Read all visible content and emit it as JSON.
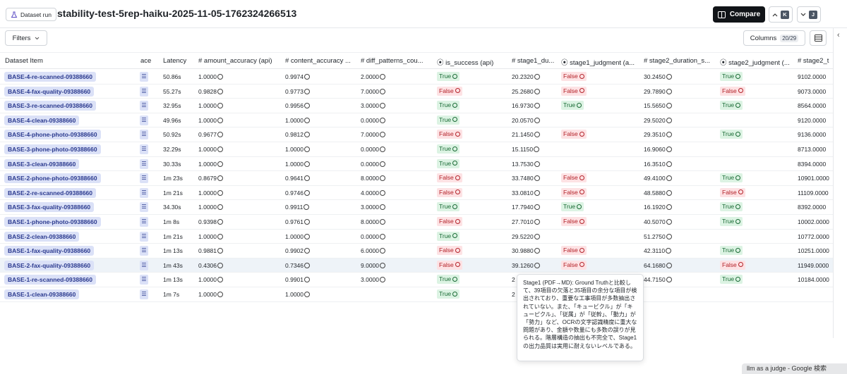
{
  "header": {
    "badge_label": "Dataset run",
    "title": "stability-test-5rep-haiku-2025-11-05-1762324266513",
    "compare_label": "Compare",
    "prev_key": "K",
    "next_key": "J"
  },
  "toolbar": {
    "filters_label": "Filters",
    "columns_label": "Columns",
    "columns_count": "20/29"
  },
  "table": {
    "headers": {
      "dataset_item": "Dataset Item",
      "trace": "ace",
      "latency": "Latency",
      "amount_accuracy": "# amount_accuracy (api)",
      "content_accuracy": "# content_accuracy ...",
      "diff_patterns": "# diff_patterns_cou...",
      "is_success": "⦿ is_success (api)",
      "stage1_duration": "# stage1_du...",
      "stage1_judgment": "⦿ stage1_judgment (a...",
      "stage2_duration": "# stage2_duration_s...",
      "stage2_judgment": "⦿ stage2_judgment (...",
      "stage2_t": "# stage2_t"
    },
    "rows": [
      {
        "item": "BASE-4-re-scanned-09388660",
        "latency": "50.86s",
        "amount": "1.0000",
        "content": "0.9974",
        "diff": "2.0000",
        "success": "True",
        "s1d": "20.2320",
        "s1j": "False",
        "s2d": "30.2450",
        "s2j": "True",
        "s2t": "9102.0000"
      },
      {
        "item": "BASE-4-fax-quality-09388660",
        "latency": "55.27s",
        "amount": "0.9828",
        "content": "0.9773",
        "diff": "7.0000",
        "success": "False",
        "s1d": "25.2680",
        "s1j": "False",
        "s2d": "29.7890",
        "s2j": "False",
        "s2t": "9073.0000"
      },
      {
        "item": "BASE-3-re-scanned-09388660",
        "latency": "32.95s",
        "amount": "1.0000",
        "content": "0.9956",
        "diff": "3.0000",
        "success": "True",
        "s1d": "16.9730",
        "s1j": "True",
        "s2d": "15.5650",
        "s2j": "True",
        "s2t": "8564.0000"
      },
      {
        "item": "BASE-4-clean-09388660",
        "latency": "49.96s",
        "amount": "1.0000",
        "content": "1.0000",
        "diff": "0.0000",
        "success": "True",
        "s1d": "20.0570",
        "s1j": "",
        "s2d": "29.5020",
        "s2j": "",
        "s2t": "9120.0000"
      },
      {
        "item": "BASE-4-phone-photo-09388660",
        "latency": "50.92s",
        "amount": "0.9677",
        "content": "0.9812",
        "diff": "7.0000",
        "success": "False",
        "s1d": "21.1450",
        "s1j": "False",
        "s2d": "29.3510",
        "s2j": "True",
        "s2t": "9136.0000"
      },
      {
        "item": "BASE-3-phone-photo-09388660",
        "latency": "32.29s",
        "amount": "1.0000",
        "content": "1.0000",
        "diff": "0.0000",
        "success": "True",
        "s1d": "15.1150",
        "s1j": "",
        "s2d": "16.9060",
        "s2j": "",
        "s2t": "8713.0000"
      },
      {
        "item": "BASE-3-clean-09388660",
        "latency": "30.33s",
        "amount": "1.0000",
        "content": "1.0000",
        "diff": "0.0000",
        "success": "True",
        "s1d": "13.7530",
        "s1j": "",
        "s2d": "16.3510",
        "s2j": "",
        "s2t": "8394.0000"
      },
      {
        "item": "BASE-2-phone-photo-09388660",
        "latency": "1m 23s",
        "amount": "0.8679",
        "content": "0.9641",
        "diff": "8.0000",
        "success": "False",
        "s1d": "33.7480",
        "s1j": "False",
        "s2d": "49.4100",
        "s2j": "True",
        "s2t": "10901.0000"
      },
      {
        "item": "BASE-2-re-scanned-09388660",
        "latency": "1m 21s",
        "amount": "1.0000",
        "content": "0.9746",
        "diff": "4.0000",
        "success": "False",
        "s1d": "33.0810",
        "s1j": "False",
        "s2d": "48.5880",
        "s2j": "False",
        "s2t": "11109.0000"
      },
      {
        "item": "BASE-3-fax-quality-09388660",
        "latency": "34.30s",
        "amount": "1.0000",
        "content": "0.9911",
        "diff": "3.0000",
        "success": "True",
        "s1d": "17.7940",
        "s1j": "True",
        "s2d": "16.1920",
        "s2j": "True",
        "s2t": "8392.0000"
      },
      {
        "item": "BASE-1-phone-photo-09388660",
        "latency": "1m 8s",
        "amount": "0.9398",
        "content": "0.9761",
        "diff": "8.0000",
        "success": "False",
        "s1d": "27.7010",
        "s1j": "False",
        "s2d": "40.5070",
        "s2j": "True",
        "s2t": "10002.0000"
      },
      {
        "item": "BASE-2-clean-09388660",
        "latency": "1m 21s",
        "amount": "1.0000",
        "content": "1.0000",
        "diff": "0.0000",
        "success": "True",
        "s1d": "29.5220",
        "s1j": "",
        "s2d": "51.2750",
        "s2j": "",
        "s2t": "10772.0000"
      },
      {
        "item": "BASE-1-fax-quality-09388660",
        "latency": "1m 13s",
        "amount": "0.9881",
        "content": "0.9902",
        "diff": "6.0000",
        "success": "False",
        "s1d": "30.9880",
        "s1j": "False",
        "s2d": "42.3110",
        "s2j": "True",
        "s2t": "10251.0000"
      },
      {
        "item": "BASE-2-fax-quality-09388660",
        "latency": "1m 43s",
        "amount": "0.4306",
        "content": "0.7346",
        "diff": "9.0000",
        "success": "False",
        "s1d": "39.1260",
        "s1j": "False",
        "s2d": "64.1680",
        "s2j": "False",
        "s2t": "11949.0000"
      },
      {
        "item": "BASE-1-re-scanned-09388660",
        "latency": "1m 13s",
        "amount": "1.0000",
        "content": "0.9901",
        "diff": "3.0000",
        "success": "True",
        "s1d": "2",
        "s1j": "",
        "s2d": "44.7150",
        "s2j": "True",
        "s2t": "10184.0000"
      },
      {
        "item": "BASE-1-clean-09388660",
        "latency": "1m 7s",
        "amount": "1.0000",
        "content": "1.0000",
        "diff": "",
        "success": "True",
        "s1d": "2",
        "s1j": "",
        "s2d": "",
        "s2j": "",
        "s2t": ""
      }
    ]
  },
  "tooltip": {
    "text": "Stage1 (PDF→MD): Ground Truthと比較して、39項目の欠落と35項目の余分な項目が検出されており、重要な工事項目が多数抽出されていない。また、「キュービクル」が「キューピクル」、「従属」が「従幹」、「動力」が「勢力」など、OCRの文字認識精度に重大な問題があり、金額や数量にも多数の誤りが見られる。階層構造の抽出も不完全で、Stage1の出力品質は実用に耐えないレベルである。"
  },
  "taskbar": {
    "tab_label": "llm as a judge - Google 検索"
  },
  "colors": {
    "true_bg": "#dcf3e3",
    "false_bg": "#fde2e4",
    "chip_bg": "#dbe1f7",
    "compare_bg": "#111418"
  }
}
